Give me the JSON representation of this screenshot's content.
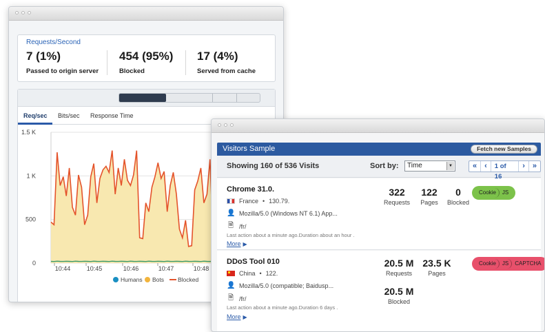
{
  "summary": {
    "label": "Requests/Second",
    "stats": [
      {
        "value": "7 (1%)",
        "caption": "Passed to origin server"
      },
      {
        "value": "454 (95%)",
        "caption": "Blocked"
      },
      {
        "value": "17 (4%)",
        "caption": "Served from cache"
      }
    ]
  },
  "chart_tabs": [
    "Req/sec",
    "Bits/sec",
    "Response Time"
  ],
  "chart_data": {
    "type": "area",
    "x_ticks": [
      "10:44",
      "10:45",
      "10:46",
      "10:47",
      "10:48"
    ],
    "y_ticks": [
      "1.5 K",
      "1 K",
      "500",
      "0"
    ],
    "ylim": [
      0,
      1500
    ],
    "legend": [
      "Humans",
      "Bots",
      "Blocked"
    ],
    "colors": {
      "humans": "#1a8fc2",
      "bots": "#f2b43c",
      "bots_fill": "#f8e8b0",
      "blocked": "#e4532b"
    },
    "series": [
      {
        "name": "Bots",
        "values": [
          480,
          450,
          1280,
          900,
          1000,
          780,
          1100,
          650,
          560,
          1020,
          880,
          450,
          560,
          1000,
          1150,
          700,
          980,
          1080,
          1120,
          1050,
          1300,
          800,
          1100,
          900,
          1200,
          960,
          900,
          1020,
          1300,
          300,
          290,
          700,
          600,
          880,
          1000,
          1160,
          980,
          1060,
          600,
          900,
          1050,
          800,
          400,
          300,
          500,
          200,
          210,
          850,
          950,
          1100,
          700,
          800,
          1200,
          300,
          280,
          600,
          900,
          1000,
          980,
          1060,
          600,
          300,
          750,
          1100,
          850,
          1200,
          900,
          300,
          700,
          950,
          800,
          1000,
          400,
          500
        ]
      },
      {
        "name": "Blocked",
        "values": [
          470,
          440,
          1270,
          890,
          990,
          770,
          1090,
          640,
          550,
          1010,
          870,
          440,
          550,
          990,
          1140,
          690,
          970,
          1070,
          1110,
          1040,
          1290,
          790,
          1090,
          890,
          1190,
          950,
          890,
          1010,
          1290,
          290,
          280,
          690,
          590,
          870,
          990,
          1150,
          970,
          1050,
          590,
          890,
          1040,
          790,
          390,
          290,
          490,
          190,
          200,
          840,
          940,
          1090,
          690,
          790,
          1190,
          290,
          270,
          590,
          890,
          990,
          970,
          1050,
          590,
          290,
          740,
          1090,
          840,
          1190,
          890,
          290,
          690,
          940,
          790,
          990,
          390,
          490
        ]
      },
      {
        "name": "Humans",
        "values": [
          20,
          18,
          22,
          20,
          19,
          21,
          20,
          18,
          22,
          20,
          19,
          21,
          20,
          18,
          22,
          20,
          19,
          21,
          20,
          18,
          22,
          20,
          19,
          21,
          20,
          18,
          22,
          20,
          19,
          21,
          20,
          18,
          22,
          20,
          19,
          21,
          20,
          18,
          22,
          20,
          19,
          21,
          20,
          18,
          22,
          20,
          19,
          21,
          20,
          18,
          22,
          20,
          19,
          21,
          20,
          18,
          22,
          20,
          19,
          21,
          20,
          18,
          22,
          20,
          19,
          21,
          20,
          18,
          22,
          20,
          19,
          21,
          20,
          18
        ]
      }
    ]
  },
  "visitors": {
    "title": "Visitors Sample",
    "fetch_label": "Fetch new Samples",
    "showing": "Showing 160 of 536 Visits",
    "sort_label": "Sort by:",
    "sort_value": "Time",
    "pager": {
      "first": "«",
      "prev": "‹",
      "info": "1 of 16",
      "next": "›",
      "last": "»"
    },
    "items": [
      {
        "name": "Chrome 31.0.",
        "country": "France",
        "ip": "130.79.",
        "agent": "Mozilla/5.0 (Windows NT 6.1) App...",
        "path": "/fr/",
        "last": "Last action about a minute ago.Duration about an hour .",
        "more": "More",
        "requests": "322",
        "requests_label": "Requests",
        "pages": "122",
        "pages_label": "Pages",
        "blocked": "0",
        "blocked_label": "Blocked",
        "tags": [
          "Cookie",
          "JS"
        ]
      },
      {
        "name": "DDoS Tool 010",
        "country": "China",
        "ip": "122.",
        "agent": "Mozilla/5.0 (compatible; Baidusp...",
        "path": "/fr/",
        "last": "Last action about a minute ago.Duration 6 days .",
        "more": "More",
        "requests": "20.5 M",
        "requests_label": "Requests",
        "pages": "23.5 K",
        "pages_label": "Pages",
        "blocked": "20.5 M",
        "blocked_label": "Blocked",
        "tags": [
          "Cookie",
          "JS",
          "CAPTCHA"
        ]
      }
    ]
  }
}
